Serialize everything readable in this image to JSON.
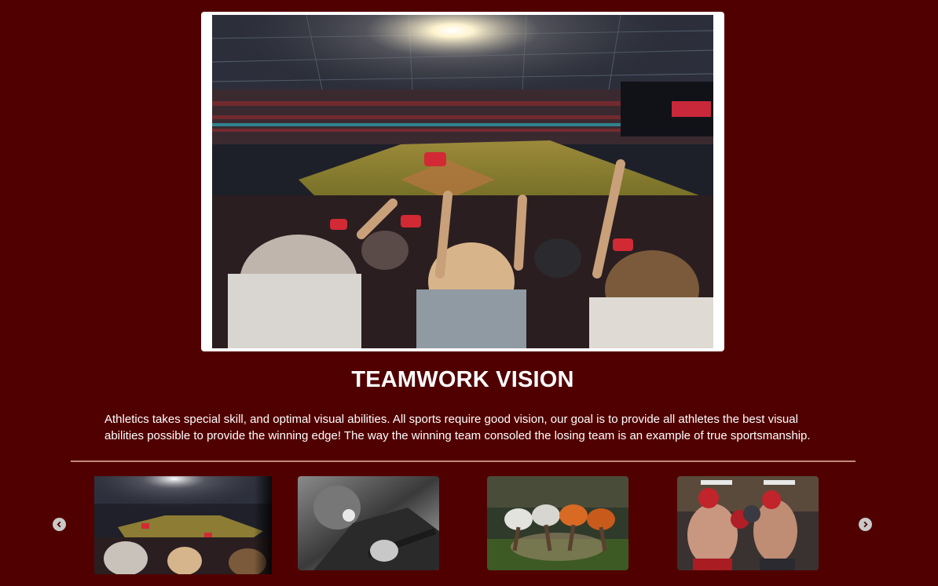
{
  "hero": {
    "image": "stadium-crowd-cheering-photo"
  },
  "main": {
    "title": "TEAMWORK VISION",
    "description": "Athletics takes special skill, and optimal visual abilities. All sports require good vision, our goal is to provide all athletes the best visual abilities possible to provide the winning edge! The way the winning team consoled the losing team is an example of true sportsmanship."
  },
  "carousel": {
    "prev_icon": "chevron-left-circle-icon",
    "next_icon": "chevron-right-circle-icon",
    "thumbnails": [
      {
        "image": "stadium-crowd-cheering-photo",
        "active": true
      },
      {
        "image": "baseball-batter-grayscale-photo",
        "active": false
      },
      {
        "image": "rugby-scrum-photo",
        "active": false
      },
      {
        "image": "boxing-match-photo",
        "active": false
      }
    ]
  },
  "colors": {
    "background": "#510000",
    "text": "#ffffff",
    "divider": "#c08a78",
    "arrow": "#c9c9c9"
  }
}
